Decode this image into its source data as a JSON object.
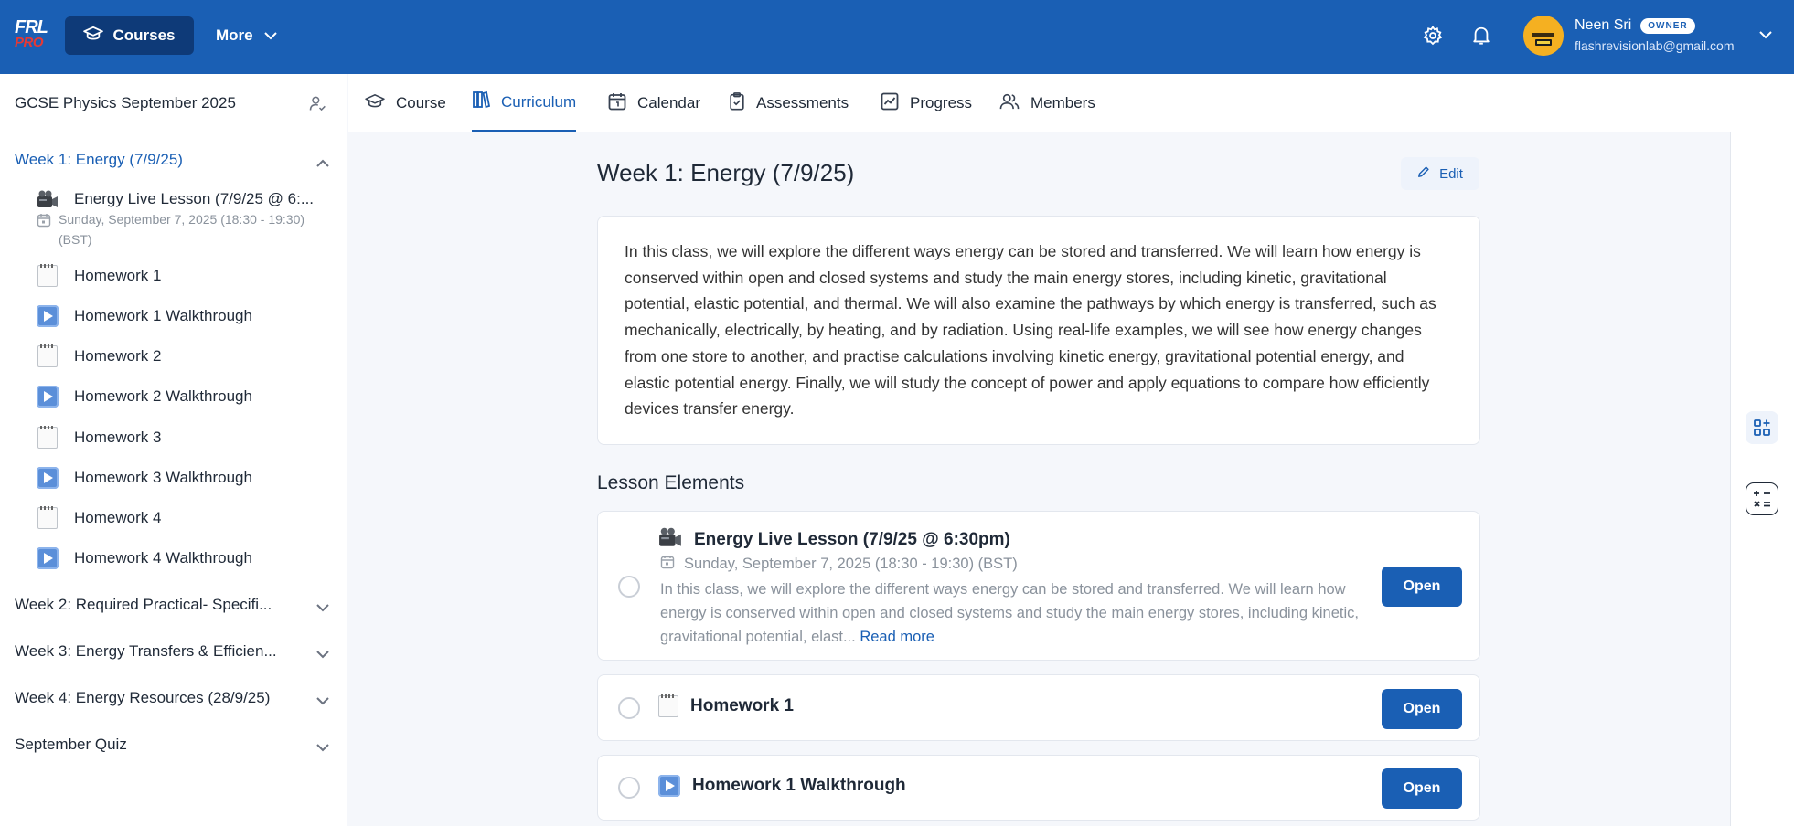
{
  "header": {
    "logo_top": "FRL",
    "logo_bottom": "PRO",
    "courses_label": "Courses",
    "more_label": "More",
    "user_name": "Neen Sri",
    "user_badge": "OWNER",
    "user_email": "flashrevisionlab@gmail.com",
    "brand_color": "#1a5fb4"
  },
  "sidebar": {
    "course_title": "GCSE Physics September 2025",
    "week1": {
      "label": "Week 1: Energy (7/9/25)",
      "items": [
        {
          "label": "Energy Live Lesson (7/9/25 @ 6:...",
          "icon": "movie-camera-icon",
          "sub": "Sunday, September 7, 2025 (18:30 - 19:30) (BST)"
        },
        {
          "label": "Homework 1",
          "icon": "notepad-icon"
        },
        {
          "label": "Homework 1 Walkthrough",
          "icon": "play-button-icon"
        },
        {
          "label": "Homework 2",
          "icon": "notepad-icon"
        },
        {
          "label": "Homework 2 Walkthrough",
          "icon": "play-button-icon"
        },
        {
          "label": "Homework 3",
          "icon": "notepad-icon"
        },
        {
          "label": "Homework 3 Walkthrough",
          "icon": "play-button-icon"
        },
        {
          "label": "Homework 4",
          "icon": "notepad-icon"
        },
        {
          "label": "Homework 4 Walkthrough",
          "icon": "play-button-icon"
        }
      ]
    },
    "weeks": [
      {
        "label": "Week 2: Required Practical- Specifi..."
      },
      {
        "label": "Week 3: Energy Transfers & Efficien..."
      },
      {
        "label": "Week 4: Energy Resources (28/9/25)"
      },
      {
        "label": "September Quiz"
      }
    ]
  },
  "tabs": [
    {
      "label": "Course",
      "icon": "graduation-cap-icon"
    },
    {
      "label": "Curriculum",
      "icon": "books-icon",
      "active": true
    },
    {
      "label": "Calendar",
      "icon": "calendar-icon"
    },
    {
      "label": "Assessments",
      "icon": "clipboard-check-icon"
    },
    {
      "label": "Progress",
      "icon": "chart-icon"
    },
    {
      "label": "Members",
      "icon": "users-icon"
    }
  ],
  "main": {
    "title": "Week 1: Energy (7/9/25)",
    "edit_label": "Edit",
    "description": "In this class, we will explore the different ways energy can be stored and transferred. We will learn how energy is conserved within open and closed systems and study the main energy stores, including kinetic, gravitational potential, elastic potential, and thermal. We will also examine the pathways by which energy is transferred, such as mechanically, electrically, by heating, and by radiation. Using real-life examples, we will see how energy changes from one store to another, and practise calculations involving kinetic energy, gravitational potential energy, and elastic potential energy. Finally, we will study the concept of power and apply equations to compare how efficiently devices transfer energy.",
    "section_title": "Lesson Elements",
    "elements": [
      {
        "title": "Energy Live Lesson (7/9/25 @ 6:30pm)",
        "date": "Sunday, September 7, 2025 (18:30 - 19:30) (BST)",
        "desc": "In this class, we will explore the different ways energy can be stored and transferred. We will learn how energy is conserved within open and closed systems and study the main energy stores, including kinetic, gravitational potential, elast...",
        "read_more": "Read more",
        "button": "Open"
      },
      {
        "title": "Homework 1",
        "button": "Open"
      },
      {
        "title": "Homework 1 Walkthrough",
        "button": "Open"
      }
    ]
  }
}
